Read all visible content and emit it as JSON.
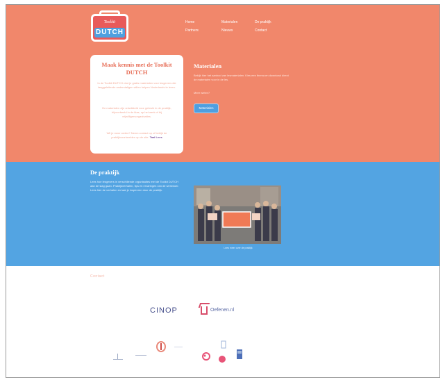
{
  "logo": {
    "top_text": "Toolkit",
    "main_text": "DUTCH"
  },
  "nav": {
    "items": [
      {
        "label": "Home"
      },
      {
        "label": "Materialen"
      },
      {
        "label": "De praktijk"
      },
      {
        "label": "Partners"
      },
      {
        "label": "Nieuws"
      },
      {
        "label": "Contact"
      }
    ]
  },
  "intro": {
    "title": "Maak kennis met de Toolkit DUTCH",
    "paragraphs": [
      "In de Toolkit DUTCH vind je gratis materialen voor lesgevers die laaggeletterde anderstaligen willen helpen Nederlands te leren.",
      "De materialen zijn ontwikkeld voor gebruik in de praktijk, bijvoorbeeld in de klas, op het werk of bij vrijwilligersorganisaties.",
      "Wil je meer weten? Neem contact op of bekijk de praktijkvoorbeelden op de site."
    ],
    "highlight_1": "Taal",
    "highlight_2": "Lees"
  },
  "materials": {
    "title": "Materialen",
    "text": "Bekijk hier het aanbod van lesmaterialen. Kies een thema en download direct de materialen voor in de les.",
    "question": "Meer weten?",
    "button_label": "Materialen"
  },
  "praktijk": {
    "title": "De praktijk",
    "text": "Lees hoe lesgevers in verschillende organisaties met de Toolkit DUTCH aan de slag gaan. Praktijkverhalen, tips en ervaringen van de werkvloer. Lees hier de verhalen en laat je inspireren door de praktijk.",
    "photo_caption": "Lees meer over de praktijk"
  },
  "footer": {
    "contact_label": "Contact",
    "partner_1": "CINOP",
    "partner_2": "Oefenen.nl"
  },
  "colors": {
    "hero": "#f1876b",
    "praktijk": "#53a4e2",
    "accent_purple": "#7c4f9d"
  }
}
